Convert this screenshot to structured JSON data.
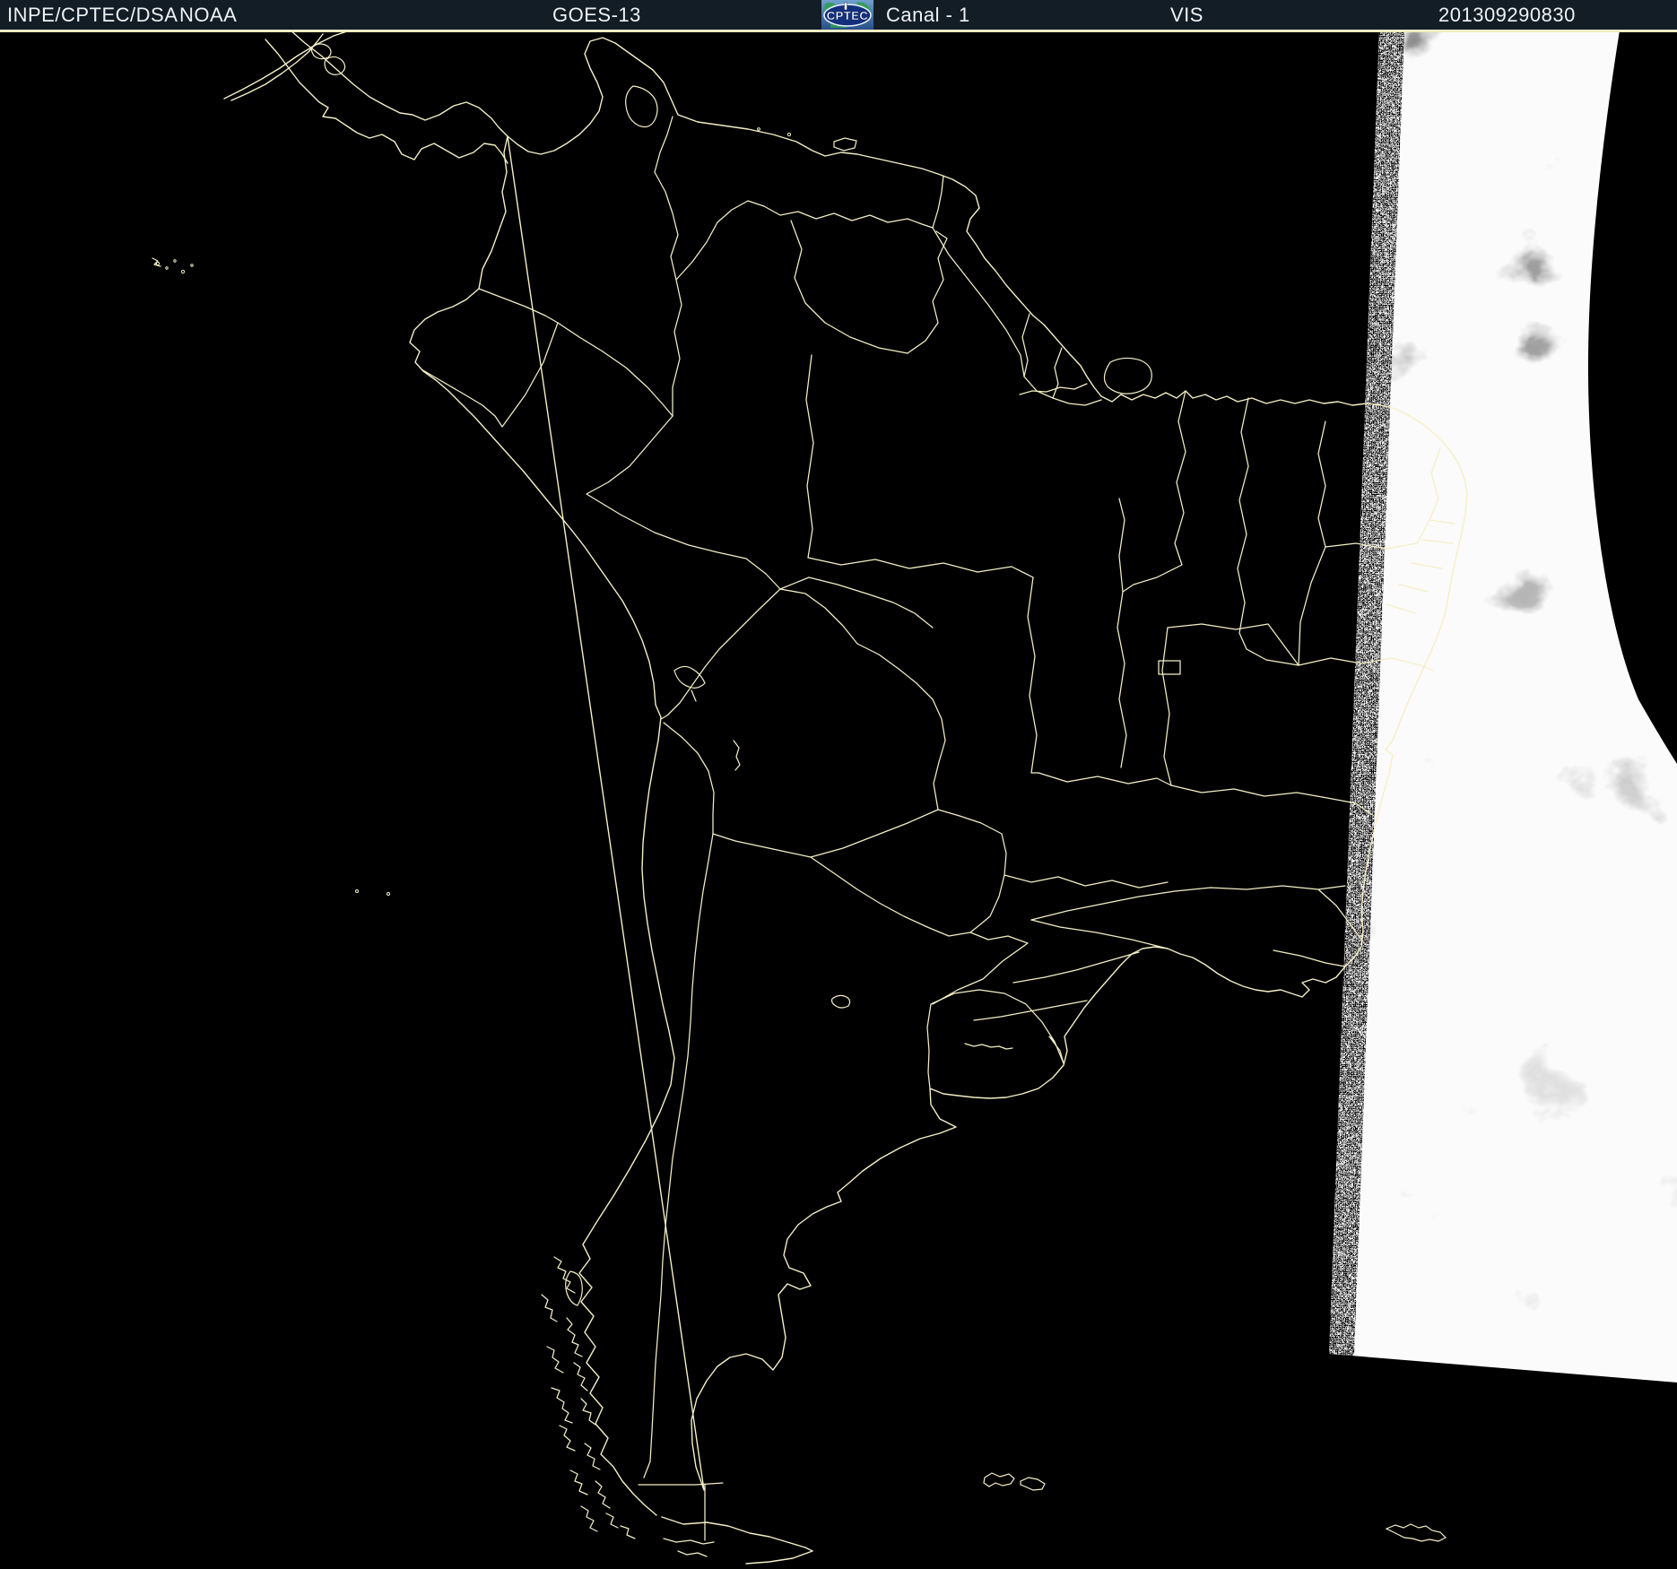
{
  "header": {
    "source": "INPE/CPTEC/DSA",
    "agency": "NOAA",
    "satellite": "GOES-13",
    "logo_text": "CPTEC",
    "channel_label": "Canal - 1",
    "band_label": "VIS",
    "timestamp": "201309290830"
  },
  "icons": {
    "logo": "cptec-globe-logo"
  },
  "colors": {
    "header_background": "#131d26",
    "header_text": "#eef2f4",
    "separator_line": "#efeac2",
    "map_background": "#000000",
    "border_lines": "#f4efc5",
    "sunlit_gray_dark": "#7e7e7e",
    "sunlit_gray_light": "#f0f0f0",
    "logo_blue_top": "#6fa0cc",
    "logo_blue_bottom": "#274f86",
    "logo_ellipse_fill": "#142f7d",
    "logo_green": "#2e9e4f"
  }
}
